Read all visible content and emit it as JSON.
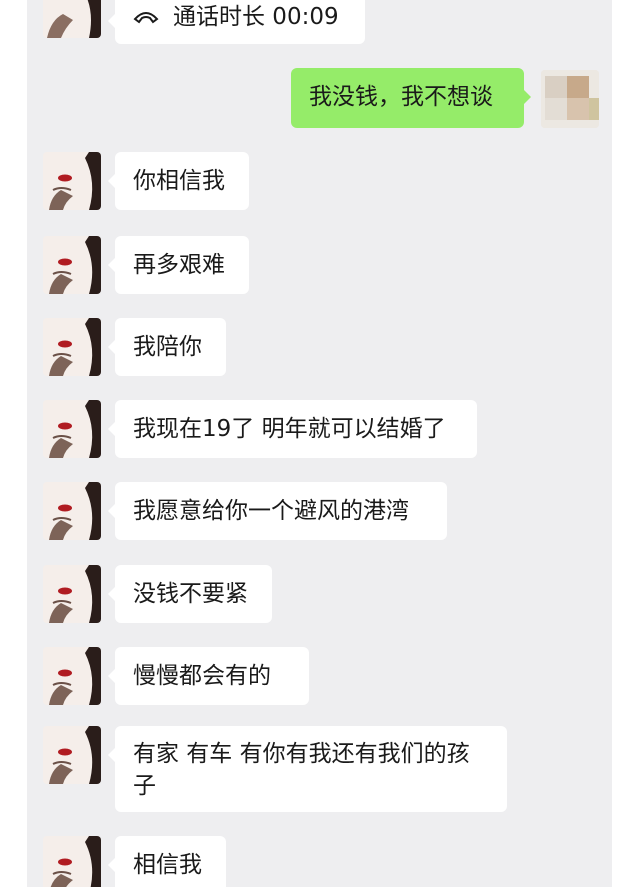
{
  "conversation": {
    "call_record": {
      "icon": "phone-icon",
      "label": "通话时长 00:09"
    },
    "messages": [
      {
        "sender": "me",
        "text": "我没钱，我不想谈"
      },
      {
        "sender": "other",
        "text": "你相信我"
      },
      {
        "sender": "other",
        "text": "再多艰难"
      },
      {
        "sender": "other",
        "text": "我陪你"
      },
      {
        "sender": "other",
        "text": "我现在19了 明年就可以结婚了"
      },
      {
        "sender": "other",
        "text": "我愿意给你一个避风的港湾"
      },
      {
        "sender": "other",
        "text": "没钱不要紧"
      },
      {
        "sender": "other",
        "text": "慢慢都会有的"
      },
      {
        "sender": "other",
        "text": "有家 有车 有你有我还有我们的孩子"
      },
      {
        "sender": "other",
        "text": "相信我"
      }
    ]
  },
  "colors": {
    "chat_background": "#eeeef0",
    "incoming_bubble": "#ffffff",
    "outgoing_bubble": "#95ec69",
    "text": "#1a1a1a"
  }
}
